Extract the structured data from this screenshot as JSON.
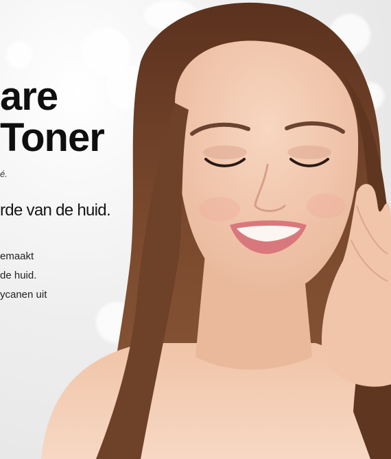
{
  "hero": {
    "headline_line1": "are",
    "headline_line2": "Toner",
    "tagline": "é.",
    "subheadline": "rde van de huid.",
    "body_lines": [
      "emaakt",
      "de huid.",
      "ycanen uit"
    ]
  },
  "colors": {
    "headline": "#0f0f0f",
    "body": "#222222",
    "background": "#eeeeee",
    "hair": "#6a3b25",
    "skin": "#f2c8ad",
    "lips": "#d9787c"
  }
}
